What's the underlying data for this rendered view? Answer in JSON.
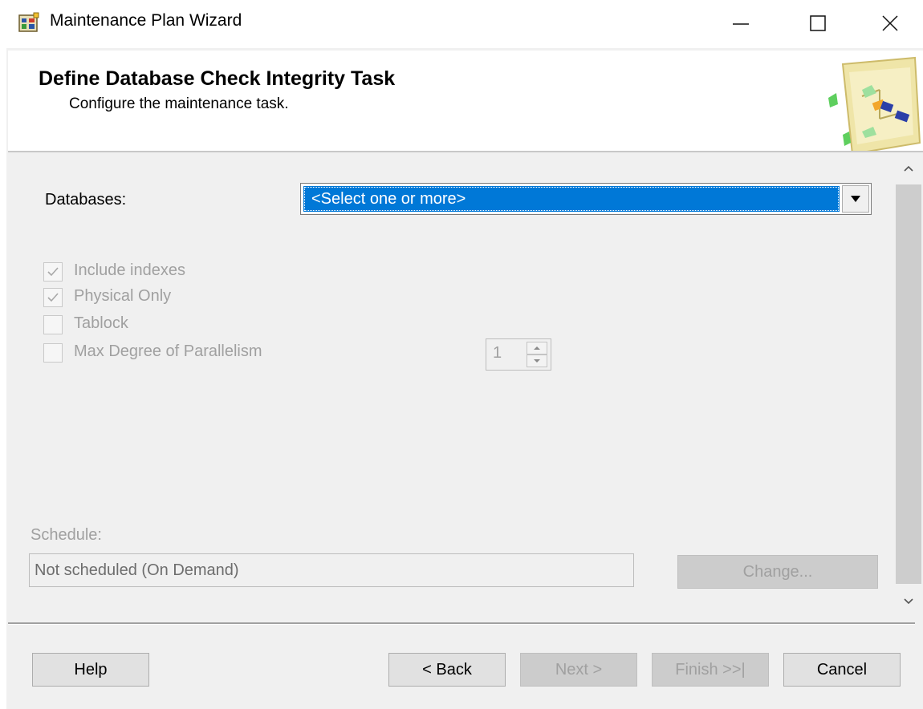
{
  "window": {
    "title": "Maintenance Plan Wizard",
    "controls": {
      "minimize": "minimize",
      "maximize": "maximize",
      "close": "close"
    }
  },
  "header": {
    "title": "Define Database Check Integrity Task",
    "subtitle": "Configure the maintenance task."
  },
  "databases": {
    "label": "Databases:",
    "selected": "<Select one or more>"
  },
  "options": {
    "include_indexes": {
      "label": "Include indexes",
      "checked": true,
      "enabled": false
    },
    "physical_only": {
      "label": "Physical Only",
      "checked": true,
      "enabled": false
    },
    "tablock": {
      "label": "Tablock",
      "checked": false,
      "enabled": false
    },
    "max_dop": {
      "label": "Max Degree of Parallelism",
      "checked": false,
      "enabled": false,
      "value": "1"
    }
  },
  "schedule": {
    "label": "Schedule:",
    "value": "Not scheduled (On Demand)",
    "change_label": "Change..."
  },
  "footer": {
    "help": "Help",
    "back": "< Back",
    "next": "Next >",
    "finish": "Finish >>|",
    "cancel": "Cancel"
  },
  "colors": {
    "selection": "#0078d7",
    "disabled_text": "#a0a0a0",
    "panel_bg": "#f0f0f0"
  }
}
